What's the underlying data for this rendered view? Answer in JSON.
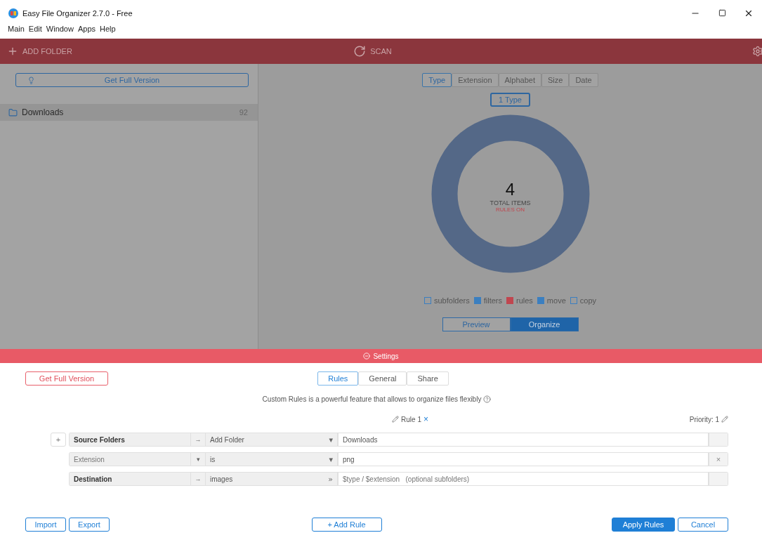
{
  "window": {
    "title": "Easy File Organizer 2.7.0 - Free"
  },
  "menu": [
    "Main",
    "Edit",
    "Window",
    "Apps",
    "Help"
  ],
  "toolbar": {
    "add_folder": "ADD FOLDER",
    "scan": "SCAN"
  },
  "sidebar": {
    "upgrade": "Get Full Version",
    "folders": [
      {
        "name": "Downloads",
        "count": "92",
        "selected": true
      }
    ]
  },
  "view_tabs": [
    {
      "label": "Type",
      "selected": true
    },
    {
      "label": "Extension",
      "selected": false
    },
    {
      "label": "Alphabet",
      "selected": false
    },
    {
      "label": "Size",
      "selected": false
    },
    {
      "label": "Date",
      "selected": false
    }
  ],
  "type_count": "1 Type",
  "summary": {
    "total": "4",
    "total_label": "TOTAL ITEMS",
    "rules_status": "RULES ON"
  },
  "legend": [
    {
      "label": "subfolders",
      "checked": false,
      "color": "#3b7fc0"
    },
    {
      "label": "filters",
      "checked": true,
      "color": "#3b7fc0"
    },
    {
      "label": "rules",
      "checked": true,
      "color": "#c0464f"
    },
    {
      "label": "move",
      "checked": true,
      "color": "#3b7fc0"
    },
    {
      "label": "copy",
      "checked": false,
      "color": "#3b7fc0"
    }
  ],
  "mode_tabs": [
    {
      "label": "Preview",
      "selected": false
    },
    {
      "label": "Organize",
      "selected": true
    }
  ],
  "settings": {
    "title": "Settings",
    "upgrade": "Get Full Version",
    "tabs": [
      {
        "label": "Rules",
        "selected": true
      },
      {
        "label": "General",
        "selected": false
      },
      {
        "label": "Share",
        "selected": false
      }
    ],
    "description": "Custom Rules is a powerful feature that allows to organize files flexibly",
    "rule": {
      "name": "Rule 1",
      "remove": "×",
      "priority": "Priority: 1"
    },
    "rows": [
      {
        "add": "+",
        "field": "Source Folders",
        "field_bold": true,
        "sep1": "→",
        "op": "Add Folder",
        "sep2": "▾",
        "value": "Downloads",
        "end": ""
      },
      {
        "field": "Extension",
        "field_bold": false,
        "sep1": "▾",
        "op": "is",
        "sep2": "▾",
        "value": "png",
        "end": "×"
      },
      {
        "field": "Destination",
        "field_bold": true,
        "sep1": "→",
        "op": "images",
        "sep2": "»",
        "placeholder": "$type / $extension   (optional subfolders)",
        "end": ""
      }
    ],
    "buttons": {
      "import": "Import",
      "export": "Export",
      "add_rule": "+ Add Rule",
      "apply": "Apply Rules",
      "cancel": "Cancel"
    }
  }
}
